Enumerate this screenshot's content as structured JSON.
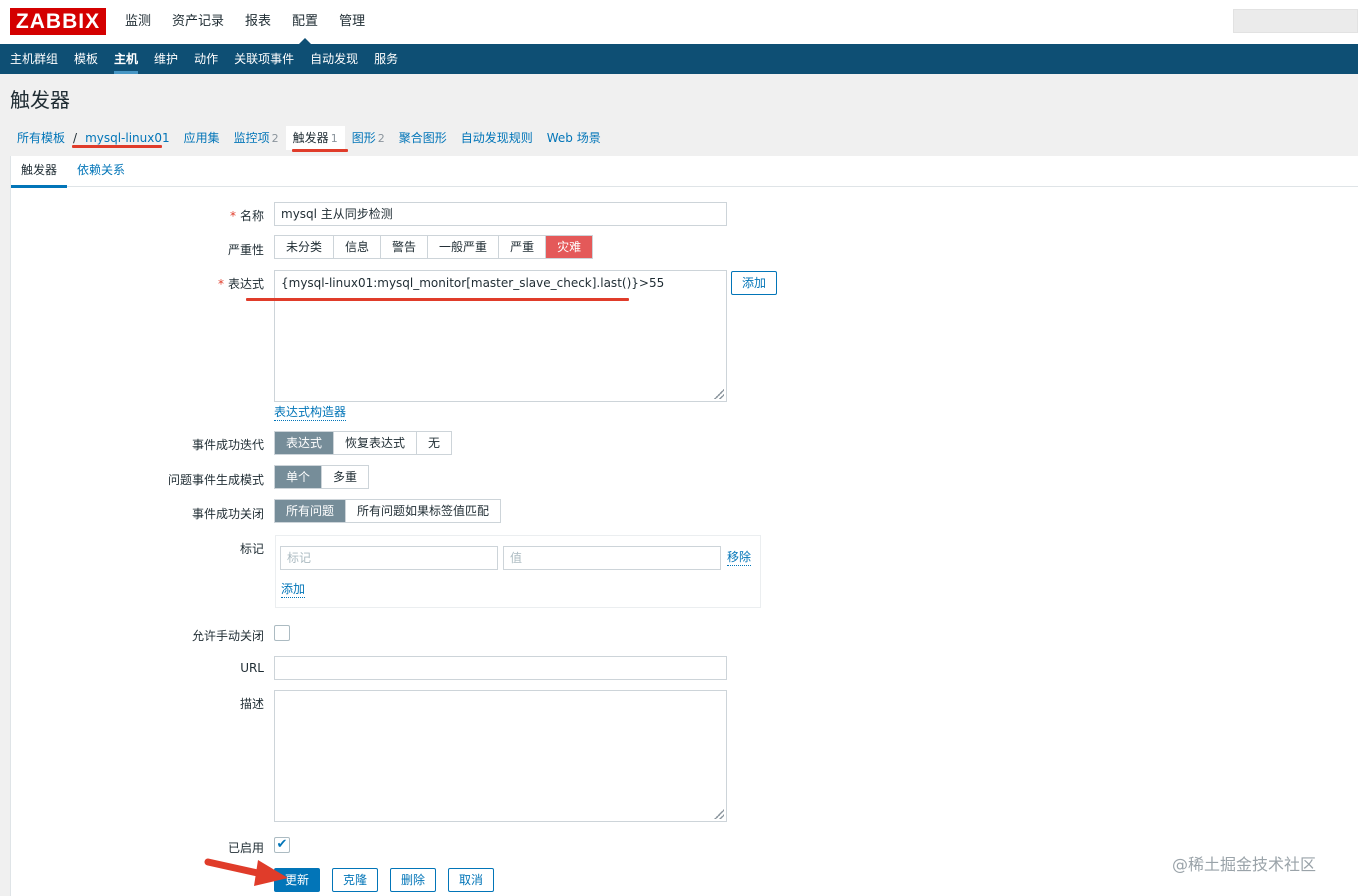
{
  "app": {
    "logo": "ZABBIX"
  },
  "main_menu": [
    "监测",
    "资产记录",
    "报表",
    "配置",
    "管理"
  ],
  "sub_menu": [
    "主机群组",
    "模板",
    "主机",
    "维护",
    "动作",
    "关联项事件",
    "自动发现",
    "服务"
  ],
  "page_title": "触发器",
  "breadcrumb": {
    "all_templates": "所有模板",
    "separator": "/",
    "host": "mysql-linux01",
    "items": [
      {
        "label": "应用集",
        "count": ""
      },
      {
        "label": "监控项",
        "count": "2"
      },
      {
        "label": "触发器",
        "count": "1"
      },
      {
        "label": "图形",
        "count": "2"
      },
      {
        "label": "聚合图形",
        "count": ""
      },
      {
        "label": "自动发现规则",
        "count": ""
      },
      {
        "label": "Web 场景",
        "count": ""
      }
    ]
  },
  "form_tabs": [
    "触发器",
    "依赖关系"
  ],
  "form": {
    "name_label": "名称",
    "name_value": "mysql 主从同步检测",
    "severity_label": "严重性",
    "severity_options": [
      "未分类",
      "信息",
      "警告",
      "一般严重",
      "严重",
      "灾难"
    ],
    "severity_selected": "灾难",
    "expression_label": "表达式",
    "expression_value": "{mysql-linux01:mysql_monitor[master_slave_check].last()}>55",
    "expression_add": "添加",
    "expression_builder": "表达式构造器",
    "ok_event_label": "事件成功迭代",
    "ok_event_options": [
      "表达式",
      "恢复表达式",
      "无"
    ],
    "problem_mode_label": "问题事件生成模式",
    "problem_mode_options": [
      "单个",
      "多重"
    ],
    "ok_close_label": "事件成功关闭",
    "ok_close_options": [
      "所有问题",
      "所有问题如果标签值匹配"
    ],
    "tags_label": "标记",
    "tag_placeholder": "标记",
    "value_placeholder": "值",
    "tag_remove": "移除",
    "tag_add": "添加",
    "manual_close_label": "允许手动关闭",
    "url_label": "URL",
    "url_value": "",
    "desc_label": "描述",
    "desc_value": "",
    "enabled_label": "已启用",
    "enabled_mark": "✔"
  },
  "actions": [
    "更新",
    "克隆",
    "删除",
    "取消"
  ],
  "watermark": "@稀土掘金技术社区",
  "colors": {
    "header": "#0e4f74",
    "accent": "#0275b8",
    "disaster": "#e45959",
    "annotation": "#e03c2a"
  }
}
